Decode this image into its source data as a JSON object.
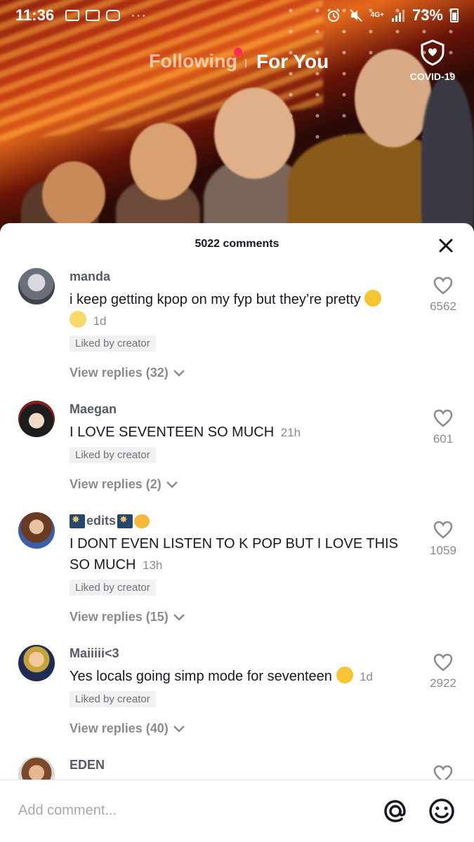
{
  "status_bar": {
    "time": "11:36",
    "network": "4G+",
    "battery": "73%",
    "more": "···"
  },
  "nav": {
    "following": "Following",
    "for_you": "For You",
    "covid": "COVID-19"
  },
  "comments_header": {
    "title": "5022 comments"
  },
  "comments": [
    {
      "username": "manda",
      "text": "i keep getting kpop on my fyp but they’re pretty",
      "time": "1d",
      "liked_label": "Liked by creator",
      "replies": "View replies (32)",
      "likes": "6562"
    },
    {
      "username": "Maegan",
      "text": "I LOVE SEVENTEEN SO MUCH",
      "time": "21h",
      "liked_label": "Liked by creator",
      "replies": "View replies (2)",
      "likes": "601"
    },
    {
      "username": "edits",
      "text": "I DONT EVEN LISTEN TO K POP BUT I LOVE THIS SO MUCH",
      "time": "13h",
      "liked_label": "Liked by creator",
      "replies": "View replies (15)",
      "likes": "1059"
    },
    {
      "username": "Maiiiii<3",
      "text": "Yes locals going simp mode for seventeen",
      "time": "1d",
      "liked_label": "Liked by creator",
      "replies": "View replies (40)",
      "likes": "2922"
    },
    {
      "username": "EDEN"
    }
  ],
  "input": {
    "placeholder": "Add comment..."
  },
  "icons": {
    "close": "close-icon",
    "heart": "heart-icon",
    "chevron": "chevron-down-icon",
    "at": "at-icon",
    "emoji": "emoji-icon",
    "shield": "shield-icon"
  },
  "colors": {
    "accent": "#fe2c55",
    "text": "#161823",
    "muted": "#8a8b91"
  }
}
